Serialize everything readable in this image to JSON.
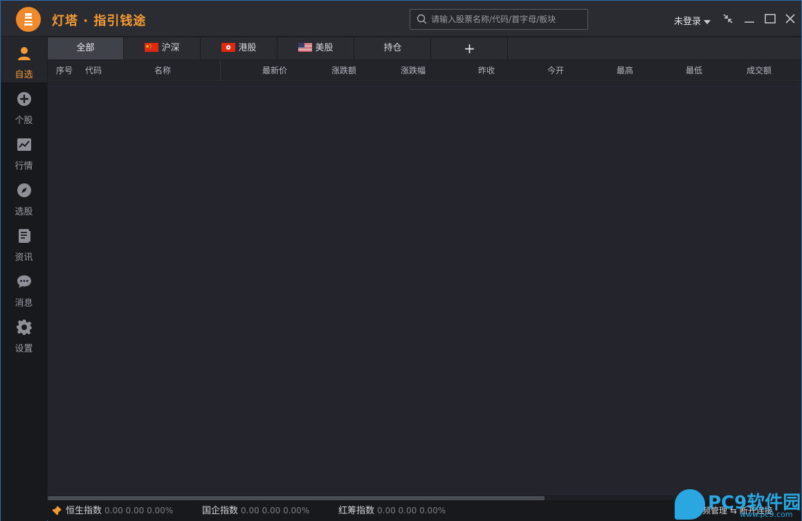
{
  "app": {
    "title": "灯塔 · 指引钱途"
  },
  "search": {
    "placeholder": "请输入股票名称/代码/首字母/板块"
  },
  "account": {
    "login_label": "未登录"
  },
  "sidebar": {
    "items": [
      {
        "label": "自选",
        "icon": "user-icon",
        "active": true
      },
      {
        "label": "个股",
        "icon": "plus-circle-icon"
      },
      {
        "label": "行情",
        "icon": "chart-icon"
      },
      {
        "label": "选股",
        "icon": "compass-icon"
      },
      {
        "label": "资讯",
        "icon": "document-icon"
      },
      {
        "label": "消息",
        "icon": "chat-bubble-icon"
      },
      {
        "label": "设置",
        "icon": "gear-icon"
      }
    ]
  },
  "tabs": [
    {
      "label": "全部",
      "active": true
    },
    {
      "label": "沪深",
      "flag": "china-flag-icon"
    },
    {
      "label": "港股",
      "flag": "hongkong-flag-icon"
    },
    {
      "label": "美股",
      "flag": "usa-flag-icon"
    },
    {
      "label": "持仓"
    },
    {
      "label": "+"
    }
  ],
  "table": {
    "columns": [
      "序号",
      "代码",
      "名称",
      "最新价",
      "涨跌额",
      "涨跌幅",
      "昨收",
      "今开",
      "最高",
      "最低",
      "成交额"
    ],
    "rows": []
  },
  "status": {
    "indices": [
      {
        "name": "恒生指数",
        "value": "0.00 0.00 0.00%"
      },
      {
        "name": "国企指数",
        "value": "0.00 0.00 0.00%"
      },
      {
        "name": "红筹指数",
        "value": "0.00 0.00 0.00%"
      }
    ],
    "right_text": "频管理 ⇆ 断开连接"
  },
  "watermark": {
    "text": "PC9软件园",
    "sub": "www.pc9.com"
  },
  "colors": {
    "accent": "#f39a33",
    "background": "#24252c",
    "titlebar": "#2b2c32",
    "sidebar": "#18191d",
    "watermark": "#2aa6e0"
  }
}
